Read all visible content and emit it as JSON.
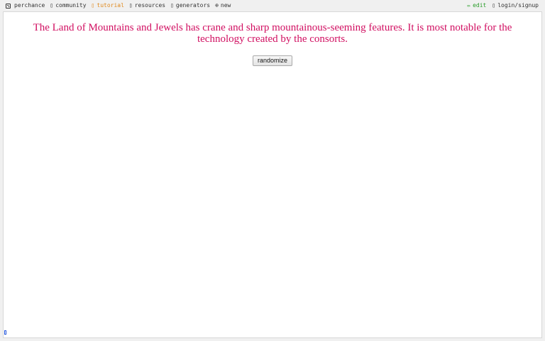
{
  "nav": {
    "brand": "perchance",
    "items": [
      {
        "label": "community",
        "icon": "community-icon",
        "glyph": "▯"
      },
      {
        "label": "tutorial",
        "icon": "tutorial-icon",
        "glyph": "▯"
      },
      {
        "label": "resources",
        "icon": "resources-icon",
        "glyph": "▯"
      },
      {
        "label": "generators",
        "icon": "generators-icon",
        "glyph": "▯"
      },
      {
        "label": "new",
        "icon": "plus-circle-icon",
        "glyph": "⊕"
      }
    ],
    "right": [
      {
        "label": "edit",
        "icon": "pencil-icon",
        "glyph": "✏"
      },
      {
        "label": "login/signup",
        "icon": "user-icon",
        "glyph": "▯"
      }
    ]
  },
  "output": {
    "text": "The Land of Mountains and Jewels has crane and sharp mountainous-seeming features. It is most notable for the technology created by the consorts."
  },
  "randomize_label": "randomize",
  "colors": {
    "output_text": "#d10f61",
    "tutorial_link": "#e08a1e",
    "edit_link": "#2a9d2a"
  }
}
